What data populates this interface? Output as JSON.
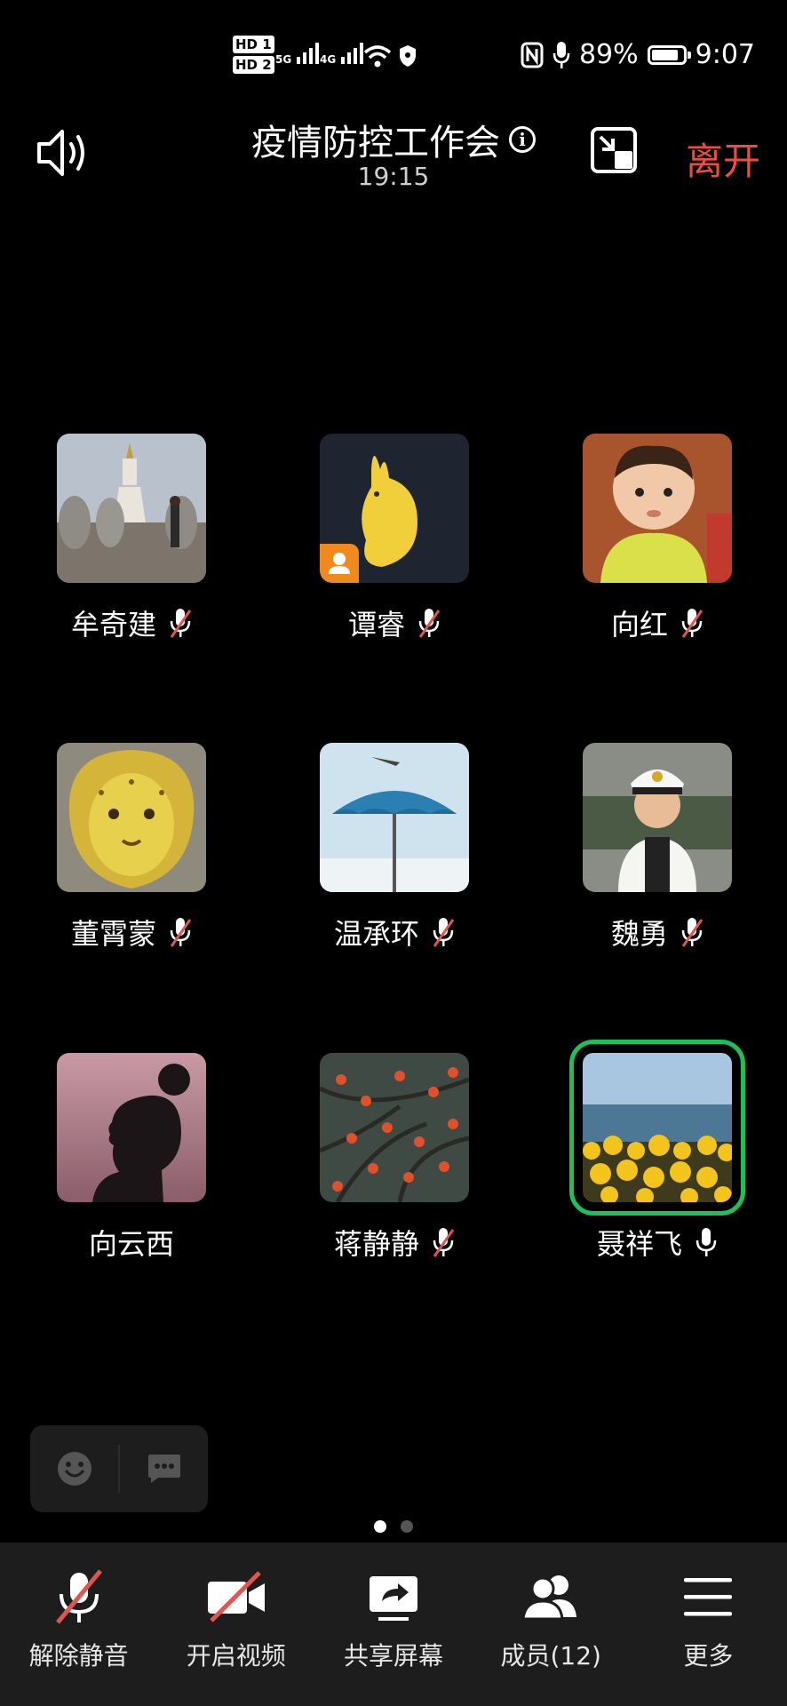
{
  "status_bar": {
    "hd1": "HD 1",
    "hd2": "HD 2",
    "net1": "5G",
    "net2": "4G",
    "battery_percent": "89%",
    "battery_level": 0.89,
    "time": "9:07"
  },
  "header": {
    "title": "疫情防控工作会",
    "timer": "19:15",
    "leave_label": "离开",
    "leave_color": "#ef4b46"
  },
  "participants": [
    {
      "name": "牟奇建",
      "mic": "muted",
      "icon": "mic-muted-icon"
    },
    {
      "name": "谭睿",
      "mic": "muted",
      "icon": "mic-muted-icon",
      "host": true
    },
    {
      "name": "向红",
      "mic": "muted",
      "icon": "mic-muted-icon"
    },
    {
      "name": "董霄蒙",
      "mic": "muted",
      "icon": "mic-muted-icon"
    },
    {
      "name": "温承环",
      "mic": "muted",
      "icon": "mic-muted-icon"
    },
    {
      "name": "魏勇",
      "mic": "muted",
      "icon": "mic-muted-icon"
    },
    {
      "name": "向云西",
      "mic": "none"
    },
    {
      "name": "蒋静静",
      "mic": "muted",
      "icon": "mic-muted-icon"
    },
    {
      "name": "聂祥飞",
      "mic": "on",
      "icon": "mic-icon",
      "speaking": true
    }
  ],
  "pager": {
    "pages": 2,
    "current": 1
  },
  "toolbar": {
    "unmute": "解除静音",
    "start_video": "开启视频",
    "share_screen": "共享屏幕",
    "members": "成员(12)",
    "more": "更多"
  },
  "colors": {
    "speaking_border": "#1fbf5a",
    "host_badge": "#f08a1c",
    "mute_slash": "#e0554f"
  }
}
